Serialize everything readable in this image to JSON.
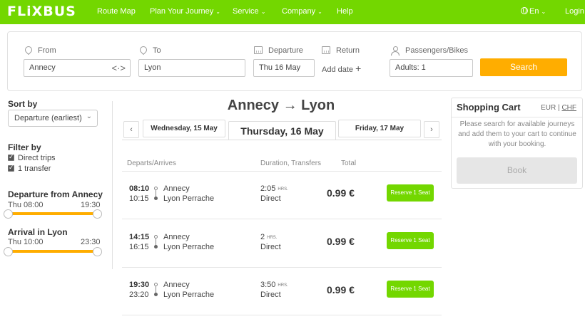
{
  "nav": {
    "logo": "FLiXBUS",
    "items": [
      {
        "label": "Route Map",
        "chevron": false
      },
      {
        "label": "Plan Your Journey",
        "chevron": true
      },
      {
        "label": "Service",
        "chevron": true
      },
      {
        "label": "Company",
        "chevron": true
      },
      {
        "label": "Help",
        "chevron": false
      }
    ],
    "language": "En",
    "login": "Login"
  },
  "search": {
    "from_label": "From",
    "from_value": "Annecy",
    "to_label": "To",
    "to_value": "Lyon",
    "departure_label": "Departure",
    "departure_value": "Thu 16 May",
    "return_label": "Return",
    "return_action": "Add date",
    "passengers_label": "Passengers/Bikes",
    "passengers_value": "Adults: 1",
    "search_button": "Search"
  },
  "sidebar": {
    "sort_heading": "Sort by",
    "sort_value": "Departure (earliest)",
    "filter_heading": "Filter by",
    "filters": [
      {
        "label": "Direct trips",
        "checked": true
      },
      {
        "label": "1 transfer",
        "checked": true
      }
    ],
    "departure_heading": "Departure from Annecy",
    "departure_from": "Thu 08:00",
    "departure_to": "19:30",
    "arrival_heading": "Arrival in Lyon",
    "arrival_from": "Thu 10:00",
    "arrival_to": "23:30"
  },
  "results": {
    "route_title": "Annecy → Lyon",
    "prev_arrow": "‹",
    "next_arrow": "›",
    "days": {
      "prev": "Wednesday, 15 May",
      "current": "Thursday, 16 May",
      "next": "Friday, 17 May"
    },
    "columns": {
      "departs": "Departs/Arrives",
      "duration": "Duration, Transfers",
      "total": "Total"
    },
    "trips": [
      {
        "depart": "08:10",
        "arrive": "10:15",
        "from": "Annecy",
        "to": "Lyon Perrache",
        "duration": "2:05",
        "duration_unit": "HRS.",
        "transfers": "Direct",
        "price": "0.99 €",
        "button": "Reserve 1 Seat"
      },
      {
        "depart": "14:15",
        "arrive": "16:15",
        "from": "Annecy",
        "to": "Lyon Perrache",
        "duration": "2",
        "duration_unit": "HRS.",
        "transfers": "Direct",
        "price": "0.99 €",
        "button": "Reserve 1 Seat"
      },
      {
        "depart": "19:30",
        "arrive": "23:20",
        "from": "Annecy",
        "to": "Lyon Perrache",
        "duration": "3:50",
        "duration_unit": "HRS.",
        "transfers": "Direct",
        "price": "0.99 €",
        "button": "Reserve 1 Seat"
      }
    ]
  },
  "cart": {
    "title": "Shopping Cart",
    "currency_eur": "EUR",
    "currency_sep": "|",
    "currency_chf": "CHF",
    "message": "Please search for available journeys and add them to your cart to continue with your booking.",
    "book_button": "Book"
  },
  "colors": {
    "brand_green": "#73d700",
    "accent_orange": "#ffad00"
  }
}
